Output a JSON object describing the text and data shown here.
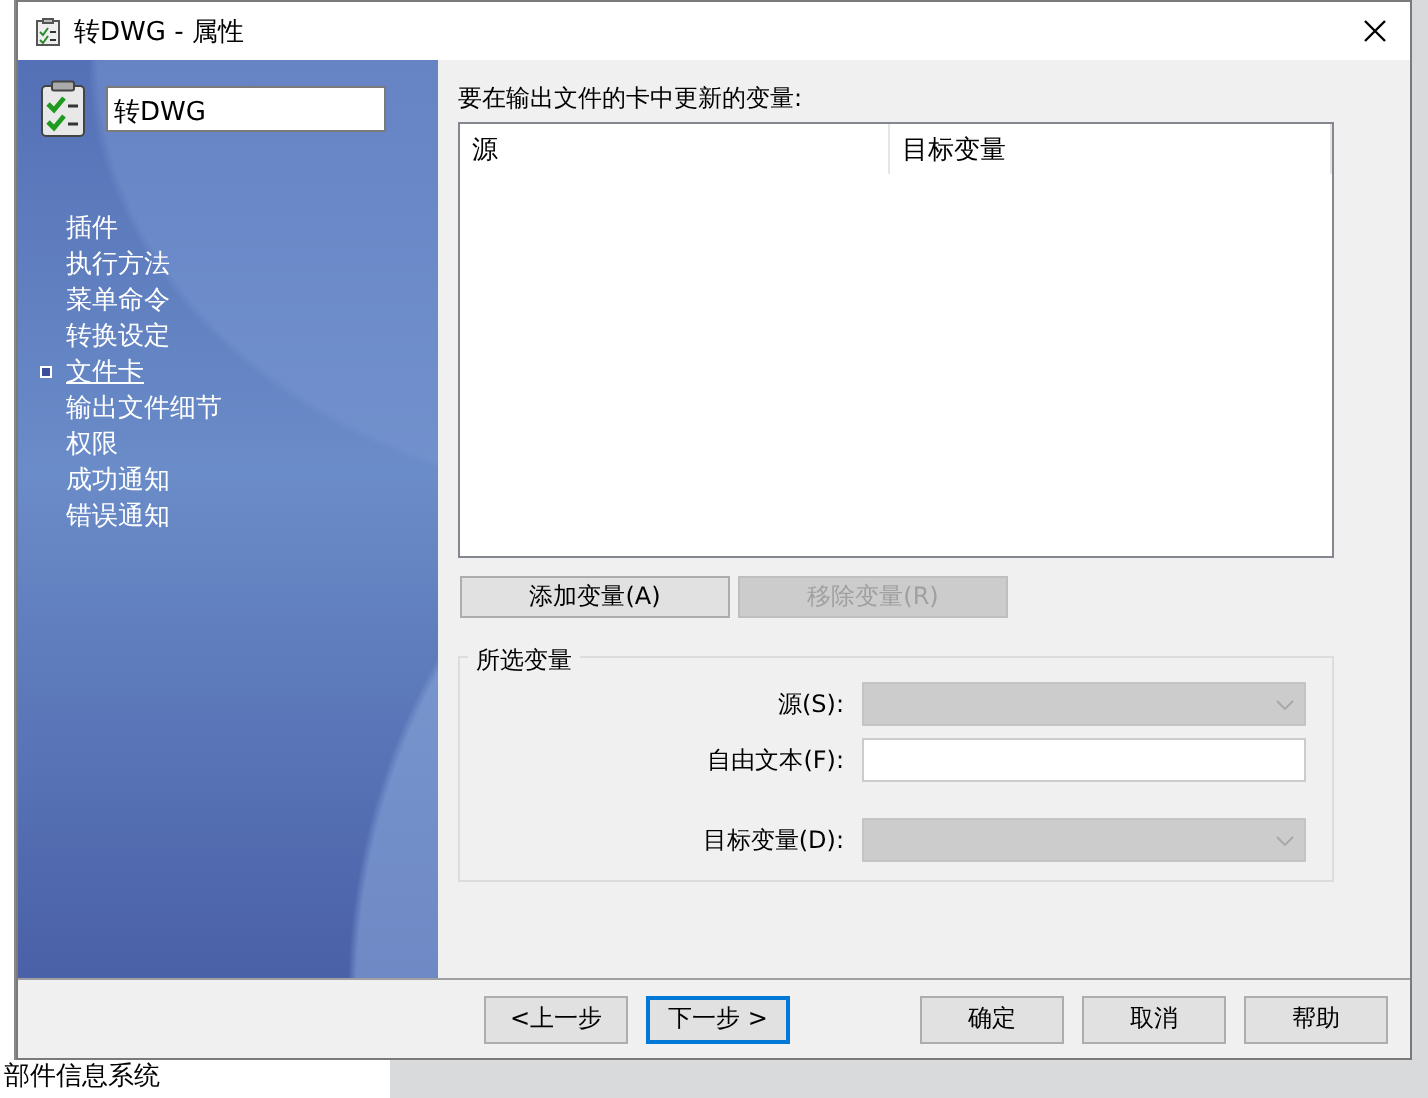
{
  "window": {
    "title": "转DWG - 属性"
  },
  "sidebar": {
    "name_field": {
      "value": "转DWG"
    },
    "items": [
      {
        "label": "插件",
        "selected": false
      },
      {
        "label": "执行方法",
        "selected": false
      },
      {
        "label": "菜单命令",
        "selected": false
      },
      {
        "label": "转换设定",
        "selected": false
      },
      {
        "label": "文件卡",
        "selected": true
      },
      {
        "label": "输出文件细节",
        "selected": false
      },
      {
        "label": "权限",
        "selected": false
      },
      {
        "label": "成功通知",
        "selected": false
      },
      {
        "label": "错误通知",
        "selected": false
      }
    ]
  },
  "variables": {
    "label": "要在输出文件的卡中更新的变量:",
    "table": {
      "columns": [
        "源",
        "目标变量"
      ]
    }
  },
  "buttons": [
    {
      "label": "添加变量(A)",
      "disabled": false
    },
    {
      "label": "移除变量(R)",
      "disabled": true
    }
  ],
  "selected_variable": {
    "title": "所选变量",
    "fields": [
      {
        "kind": "dropdown",
        "label": "源(S):",
        "disabled": true
      },
      {
        "kind": "text",
        "label": "自由文本(F):",
        "disabled": false
      },
      {
        "kind": "dropdown",
        "label": "目标变量(D):",
        "disabled": true
      }
    ]
  },
  "footer": {
    "nav_buttons": [
      {
        "label": "<上一步",
        "focused": false
      },
      {
        "label": "下一步 >",
        "focused": true
      }
    ],
    "buttons": [
      "确定",
      "取消",
      "帮助"
    ]
  },
  "background_window": {
    "text": "部件信息系统"
  }
}
